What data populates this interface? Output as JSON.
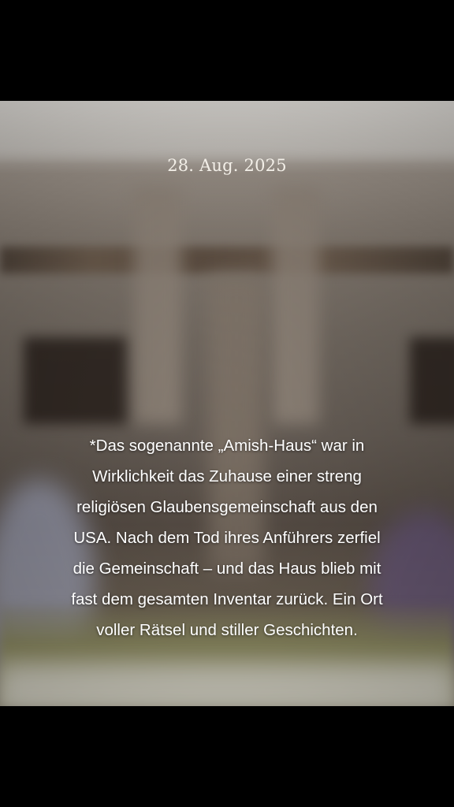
{
  "post": {
    "date": "28. Aug. 2025",
    "caption_lines": [
      "*Das sogenannte „Amish-Haus“ war in",
      "Wirklichkeit das Zuhause einer streng",
      "religiösen Glaubensgemeinschaft aus den",
      "USA. Nach dem Tod ihres Anführers zerfiel",
      "die Gemeinschaft – und das Haus blieb mit",
      "fast dem gesamten Inventar zurück. Ein Ort",
      "voller Rätsel und stiller Geschichten."
    ]
  }
}
